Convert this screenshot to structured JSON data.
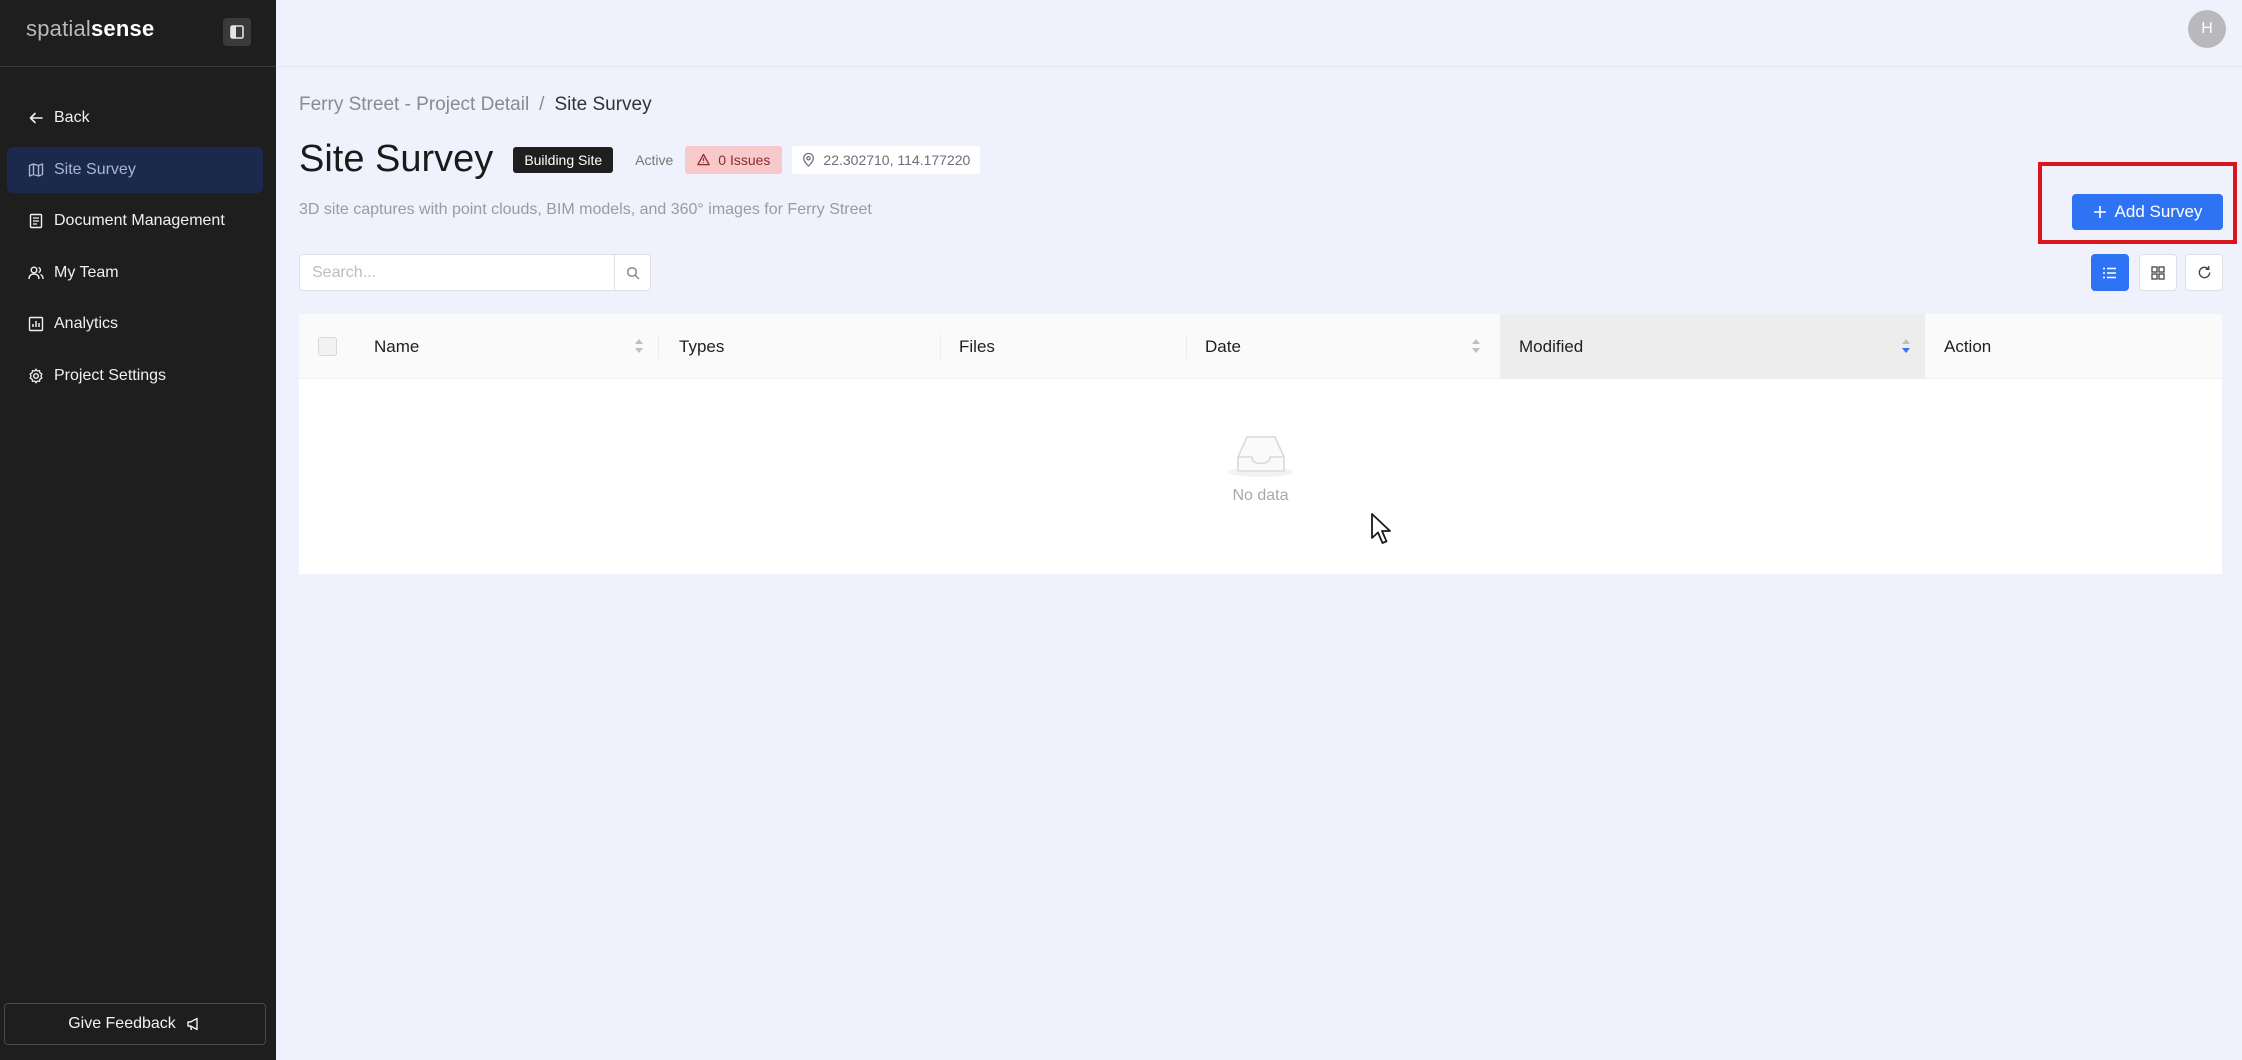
{
  "app": {
    "logo_part1": "spatial",
    "logo_part2": "sense"
  },
  "sidebar": {
    "items": [
      {
        "label": "Back",
        "icon": "arrow-left-icon"
      },
      {
        "label": "Site Survey",
        "icon": "map-icon",
        "active": true
      },
      {
        "label": "Document Management",
        "icon": "document-icon"
      },
      {
        "label": "My Team",
        "icon": "team-icon"
      },
      {
        "label": "Analytics",
        "icon": "chart-icon"
      },
      {
        "label": "Project Settings",
        "icon": "gear-icon"
      }
    ],
    "feedback_label": "Give Feedback"
  },
  "topbar": {
    "avatar_initial": "H"
  },
  "breadcrumb": {
    "parent": "Ferry Street - Project Detail",
    "separator": "/",
    "current": "Site Survey"
  },
  "header": {
    "title": "Site Survey",
    "site_tag": "Building Site",
    "status": "Active",
    "issues": "0 Issues",
    "coordinates": "22.302710, 114.177220",
    "subtitle": "3D site captures with point clouds, BIM models, and 360° images for Ferry Street"
  },
  "actions": {
    "add_survey": "Add Survey"
  },
  "search": {
    "placeholder": "Search..."
  },
  "table": {
    "columns": [
      "Name",
      "Types",
      "Files",
      "Date",
      "Modified",
      "Action"
    ],
    "empty_text": "No data"
  },
  "colors": {
    "primary": "#2f73f5",
    "sidebar_bg": "#1e1e1f",
    "page_bg": "#eff2fc",
    "highlight_frame": "#d9161d",
    "issues_bg": "#f8c9cb"
  }
}
